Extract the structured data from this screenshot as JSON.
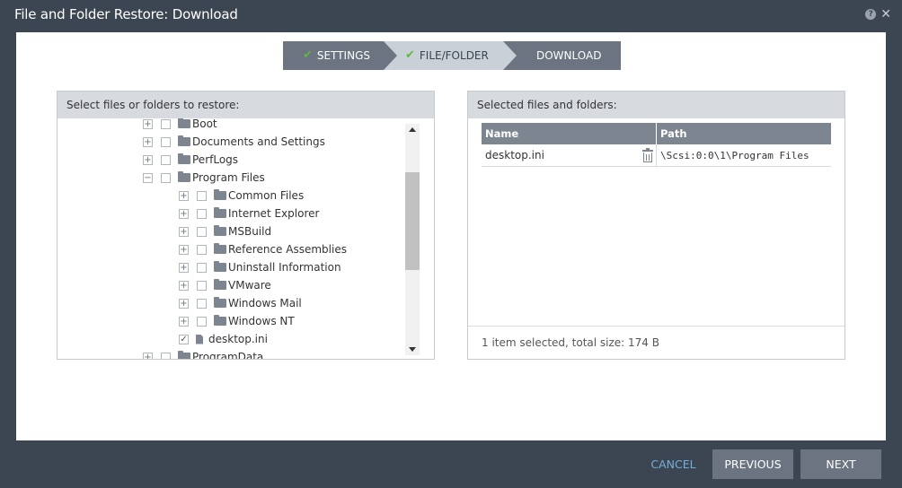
{
  "window": {
    "title": "File and Folder Restore: Download",
    "help_icon": "question-mark",
    "close_icon": "x"
  },
  "steps": [
    {
      "label": "SETTINGS",
      "done": true
    },
    {
      "label": "FILE/FOLDER",
      "done": true,
      "active": true
    },
    {
      "label": "DOWNLOAD",
      "done": false
    }
  ],
  "left_panel": {
    "header": "Select files or folders to restore:",
    "tree": [
      {
        "label": "Boot",
        "type": "folder",
        "expander": "+",
        "checked": false
      },
      {
        "label": "Documents and Settings",
        "type": "folder",
        "expander": "+",
        "checked": false
      },
      {
        "label": "PerfLogs",
        "type": "folder",
        "expander": "+",
        "checked": false
      },
      {
        "label": "Program Files",
        "type": "folder-open",
        "expander": "−",
        "checked": false
      },
      {
        "label": "Common Files",
        "type": "folder",
        "expander": "+",
        "checked": false
      },
      {
        "label": "Internet Explorer",
        "type": "folder",
        "expander": "+",
        "checked": false
      },
      {
        "label": "MSBuild",
        "type": "folder",
        "expander": "+",
        "checked": false
      },
      {
        "label": "Reference Assemblies",
        "type": "folder",
        "expander": "+",
        "checked": false
      },
      {
        "label": "Uninstall Information",
        "type": "folder",
        "expander": "+",
        "checked": false
      },
      {
        "label": "VMware",
        "type": "folder",
        "expander": "+",
        "checked": false
      },
      {
        "label": "Windows Mail",
        "type": "folder",
        "expander": "+",
        "checked": false
      },
      {
        "label": "Windows NT",
        "type": "folder",
        "expander": "+",
        "checked": false
      },
      {
        "label": "desktop.ini",
        "type": "file",
        "expander": "",
        "checked": true
      },
      {
        "label": "ProgramData",
        "type": "folder",
        "expander": "+",
        "checked": false
      }
    ]
  },
  "right_panel": {
    "header": "Selected files and folders:",
    "columns": [
      "Name",
      "Path"
    ],
    "rows": [
      {
        "name": "desktop.ini",
        "path": "\\Scsi:0:0\\1\\Program Files"
      }
    ],
    "summary": "1 item selected, total size: 174 B"
  },
  "buttons": {
    "cancel": "CANCEL",
    "previous": "PREVIOUS",
    "next": "NEXT"
  },
  "colors": {
    "dialog_bg": "#3c4552",
    "step_active": "#c9d0d7",
    "step_inactive": "#6b7480",
    "check": "#5fba3a",
    "cancel_link": "#74b0d6"
  }
}
